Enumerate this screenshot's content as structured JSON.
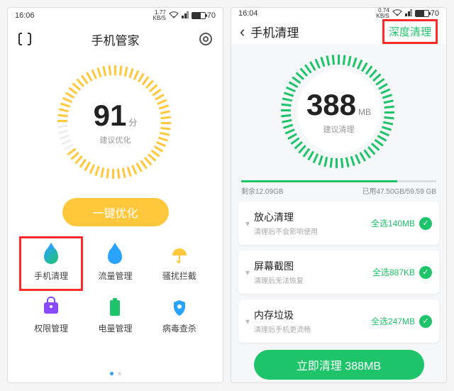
{
  "left": {
    "status": {
      "time": "16:06",
      "net_speed": "1.77\nKB/S",
      "battery_pct": "70"
    },
    "title": "手机管家",
    "score": "91",
    "score_unit": "分",
    "score_sub": "建议优化",
    "optimize_label": "一键优化",
    "features": [
      {
        "key": "clean",
        "label": "手机清理"
      },
      {
        "key": "data",
        "label": "流量管理"
      },
      {
        "key": "block",
        "label": "骚扰拦截"
      },
      {
        "key": "perm",
        "label": "权限管理"
      },
      {
        "key": "battery",
        "label": "电量管理"
      },
      {
        "key": "virus",
        "label": "病毒查杀"
      }
    ],
    "gauge_color": "#ffc83c",
    "gauge_pct": 91
  },
  "right": {
    "status": {
      "time": "16:04",
      "net_speed": "0.74\nKB/S",
      "battery_pct": "70"
    },
    "title": "手机清理",
    "deep_label": "深度清理",
    "score": "388",
    "score_unit": "MB",
    "score_sub": "建议清理",
    "storage": {
      "free_label": "剩余12.09GB",
      "used_label": "已用47.50GB/59.59 GB",
      "used_pct": 80
    },
    "items": [
      {
        "title": "放心清理",
        "sub": "清理后不会影响使用",
        "size_label": "全选140MB"
      },
      {
        "title": "屏幕截图",
        "sub": "清理后无法恢复",
        "size_label": "全选887KB"
      },
      {
        "title": "内存垃圾",
        "sub": "清理后手机更流畅",
        "size_label": "全选247MB"
      }
    ],
    "clean_now_label": "立即清理 388MB",
    "gauge_color": "#1ec46a",
    "gauge_pct": 100
  }
}
